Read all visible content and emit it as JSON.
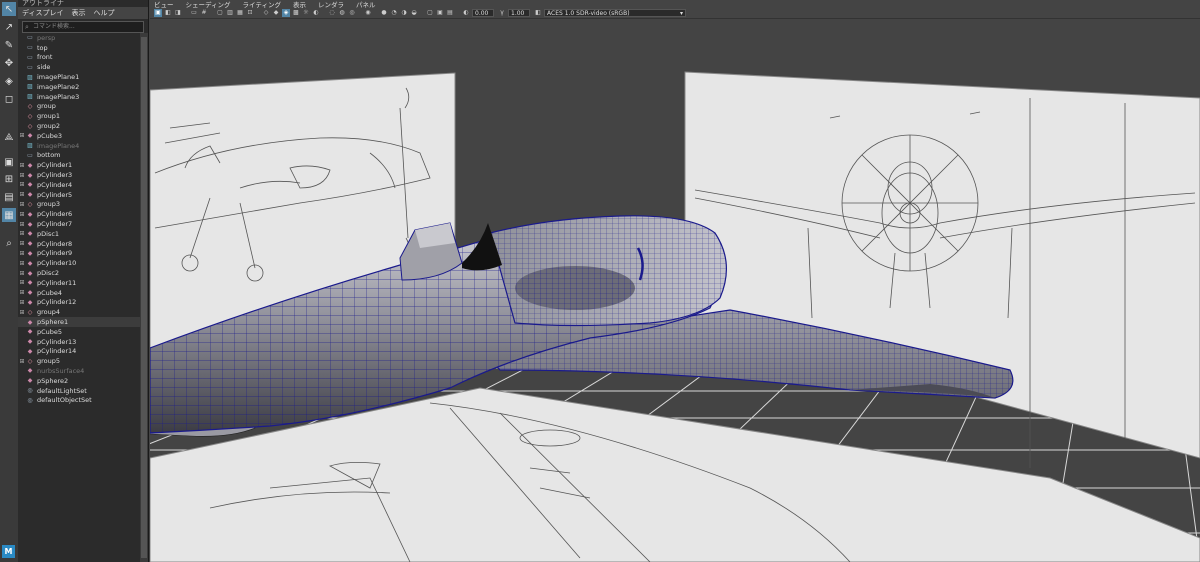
{
  "outliner": {
    "title": "アウトライナ",
    "menu": [
      "ディスプレイ",
      "表示",
      "ヘルプ"
    ],
    "search_placeholder": "コマンド検索...",
    "items": [
      {
        "label": "persp",
        "type": "camera",
        "dim": true,
        "exp": ""
      },
      {
        "label": "top",
        "type": "camera",
        "dim": false,
        "exp": ""
      },
      {
        "label": "front",
        "type": "camera",
        "dim": false,
        "exp": ""
      },
      {
        "label": "side",
        "type": "camera",
        "dim": false,
        "exp": ""
      },
      {
        "label": "imagePlane1",
        "type": "image",
        "dim": false,
        "exp": ""
      },
      {
        "label": "imagePlane2",
        "type": "image",
        "dim": false,
        "exp": ""
      },
      {
        "label": "imagePlane3",
        "type": "image",
        "dim": false,
        "exp": ""
      },
      {
        "label": "group",
        "type": "group",
        "dim": false,
        "exp": ""
      },
      {
        "label": "group1",
        "type": "group",
        "dim": false,
        "exp": ""
      },
      {
        "label": "group2",
        "type": "group",
        "dim": false,
        "exp": ""
      },
      {
        "label": "pCube3",
        "type": "mesh",
        "dim": false,
        "exp": "+"
      },
      {
        "label": "imagePlane4",
        "type": "image",
        "dim": true,
        "exp": ""
      },
      {
        "label": "bottom",
        "type": "camera",
        "dim": false,
        "exp": ""
      },
      {
        "label": "pCylinder1",
        "type": "mesh",
        "dim": false,
        "exp": "+"
      },
      {
        "label": "pCylinder3",
        "type": "mesh",
        "dim": false,
        "exp": "+"
      },
      {
        "label": "pCylinder4",
        "type": "mesh",
        "dim": false,
        "exp": "+"
      },
      {
        "label": "pCylinder5",
        "type": "mesh",
        "dim": false,
        "exp": "+"
      },
      {
        "label": "group3",
        "type": "group",
        "dim": false,
        "exp": "+"
      },
      {
        "label": "pCylinder6",
        "type": "mesh",
        "dim": false,
        "exp": "+"
      },
      {
        "label": "pCylinder7",
        "type": "mesh",
        "dim": false,
        "exp": "+"
      },
      {
        "label": "pDisc1",
        "type": "mesh",
        "dim": false,
        "exp": "+"
      },
      {
        "label": "pCylinder8",
        "type": "mesh",
        "dim": false,
        "exp": "+"
      },
      {
        "label": "pCylinder9",
        "type": "mesh",
        "dim": false,
        "exp": "+"
      },
      {
        "label": "pCylinder10",
        "type": "mesh",
        "dim": false,
        "exp": "+"
      },
      {
        "label": "pDisc2",
        "type": "mesh",
        "dim": false,
        "exp": "+"
      },
      {
        "label": "pCylinder11",
        "type": "mesh",
        "dim": false,
        "exp": "+"
      },
      {
        "label": "pCube4",
        "type": "mesh",
        "dim": false,
        "exp": "+"
      },
      {
        "label": "pCylinder12",
        "type": "mesh",
        "dim": false,
        "exp": "+"
      },
      {
        "label": "group4",
        "type": "group",
        "dim": false,
        "exp": "+"
      },
      {
        "label": "pSphere1",
        "type": "mesh",
        "dim": false,
        "exp": "",
        "selected": true
      },
      {
        "label": "pCube5",
        "type": "mesh",
        "dim": false,
        "exp": ""
      },
      {
        "label": "pCylinder13",
        "type": "mesh",
        "dim": false,
        "exp": ""
      },
      {
        "label": "pCylinder14",
        "type": "mesh",
        "dim": false,
        "exp": ""
      },
      {
        "label": "group5",
        "type": "group",
        "dim": false,
        "exp": "+"
      },
      {
        "label": "nurbsSurface4",
        "type": "mesh",
        "dim": true,
        "exp": ""
      },
      {
        "label": "pSphere2",
        "type": "mesh",
        "dim": false,
        "exp": ""
      },
      {
        "label": "defaultLightSet",
        "type": "set",
        "dim": false,
        "exp": ""
      },
      {
        "label": "defaultObjectSet",
        "type": "set",
        "dim": false,
        "exp": ""
      }
    ]
  },
  "viewport": {
    "menu": [
      "ビュー",
      "シェーディング",
      "ライティング",
      "表示",
      "レンダラ",
      "パネル"
    ],
    "exposure": "0.00",
    "gamma": "1.00",
    "colorspace": "ACES 1.0 SDR-video (sRGB)"
  },
  "toolbox": {
    "logo": "M"
  },
  "colors": {
    "wire": "#1a1a8c",
    "grid": "#d8d8d8",
    "accent": "#5285a6"
  }
}
